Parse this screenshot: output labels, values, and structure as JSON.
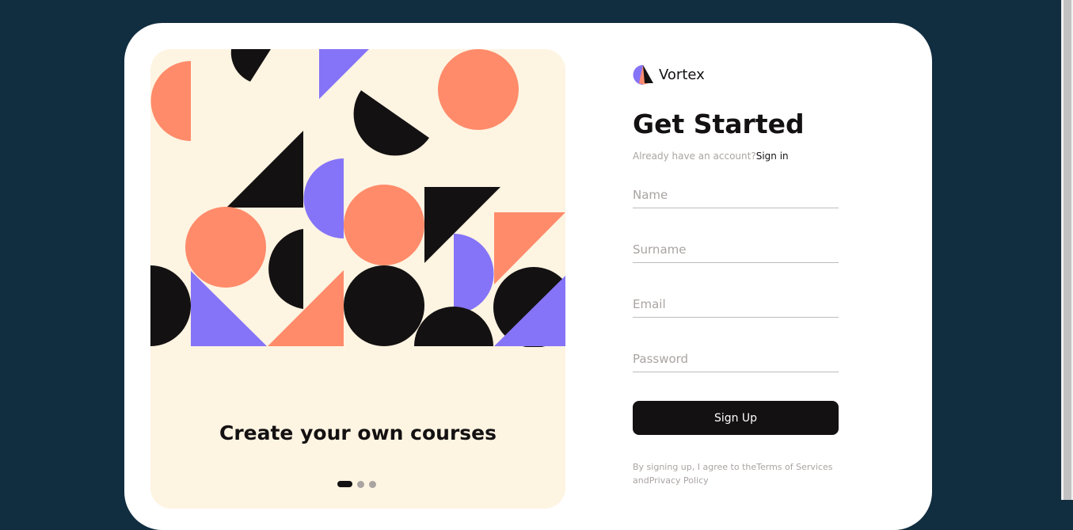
{
  "colors": {
    "background": "#112d40",
    "card": "#ffffff",
    "panel": "#fef4e2",
    "ink": "#141112",
    "coral": "#ff8b6a",
    "violet": "#8574f7",
    "muted": "#a9a4a2"
  },
  "carousel": {
    "caption": "Create your own courses",
    "slide_count": 3,
    "active_slide": 1
  },
  "brand": {
    "logo_icon": "vortex-logo-icon",
    "name": "Vortex"
  },
  "form": {
    "title": "Get Started",
    "have_account_text": "Already have an account?",
    "signin_label": "Sign in",
    "name_placeholder": "Name",
    "surname_placeholder": "Surname",
    "email_placeholder": "Email",
    "password_placeholder": "Password",
    "submit_label": "Sign Up",
    "terms_prefix": "By signing up, I agree to the",
    "terms_link": "Terms of Services",
    "and_text": "and",
    "privacy_link": "Privacy Policy"
  }
}
